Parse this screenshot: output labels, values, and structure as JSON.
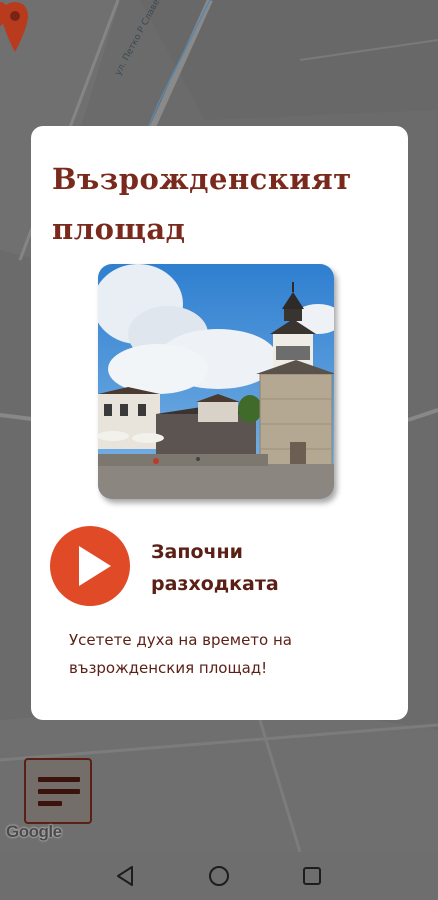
{
  "map": {
    "street_label": "ул. Петко Р Славейков",
    "google_logo": "Google"
  },
  "dialog": {
    "title": "Възрожденският площад",
    "start_label": "Започни разходката",
    "description": "Усетете духа на времето на възрожденския площад!",
    "photo_alt": "clock-tower-square-photo",
    "accent_color": "#e04a26",
    "title_color": "#7a2a1c"
  },
  "menu": {
    "icon": "hamburger-menu-icon"
  },
  "navbar": {
    "back": "back-triangle-icon",
    "home": "home-circle-icon",
    "recents": "recents-square-icon"
  }
}
